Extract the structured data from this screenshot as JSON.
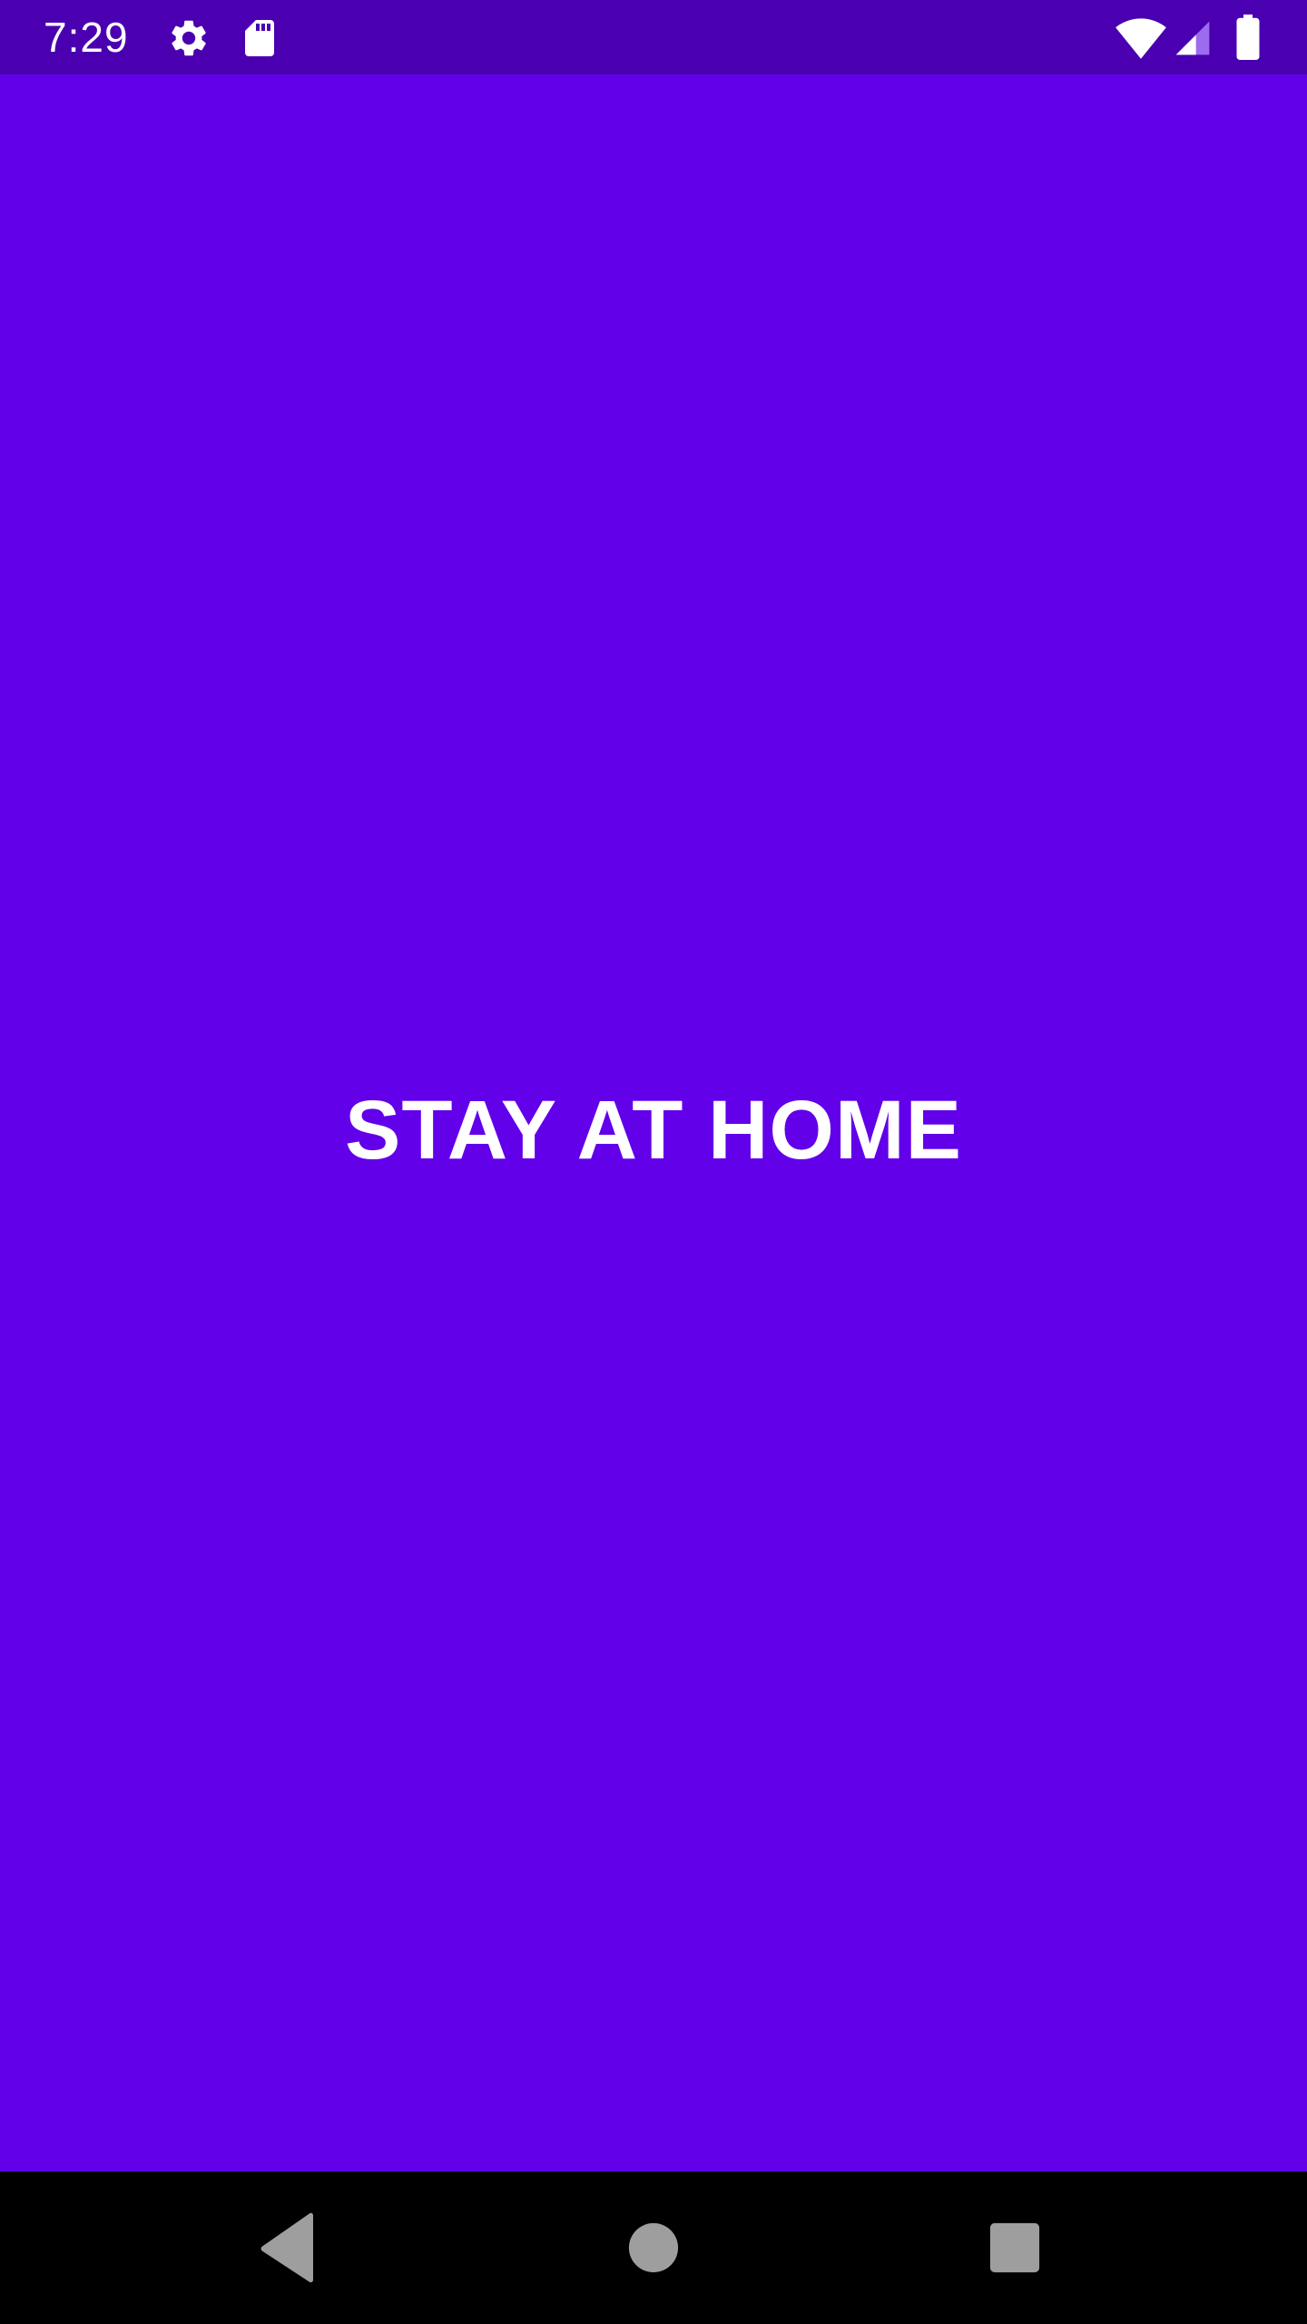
{
  "status_bar": {
    "time": "7:29",
    "left_icons": [
      "gear-icon",
      "sd-card-icon"
    ],
    "right_icons": [
      "wifi-icon",
      "cell-signal-icon",
      "battery-icon"
    ],
    "background": "#4a00b0"
  },
  "main": {
    "headline": "STAY AT HOME",
    "background": "#6200ea",
    "text_color": "#ffffff"
  },
  "nav_bar": {
    "buttons": [
      "back-icon",
      "home-icon",
      "recents-icon"
    ],
    "background": "#000000",
    "icon_color": "#9e9e9e"
  }
}
